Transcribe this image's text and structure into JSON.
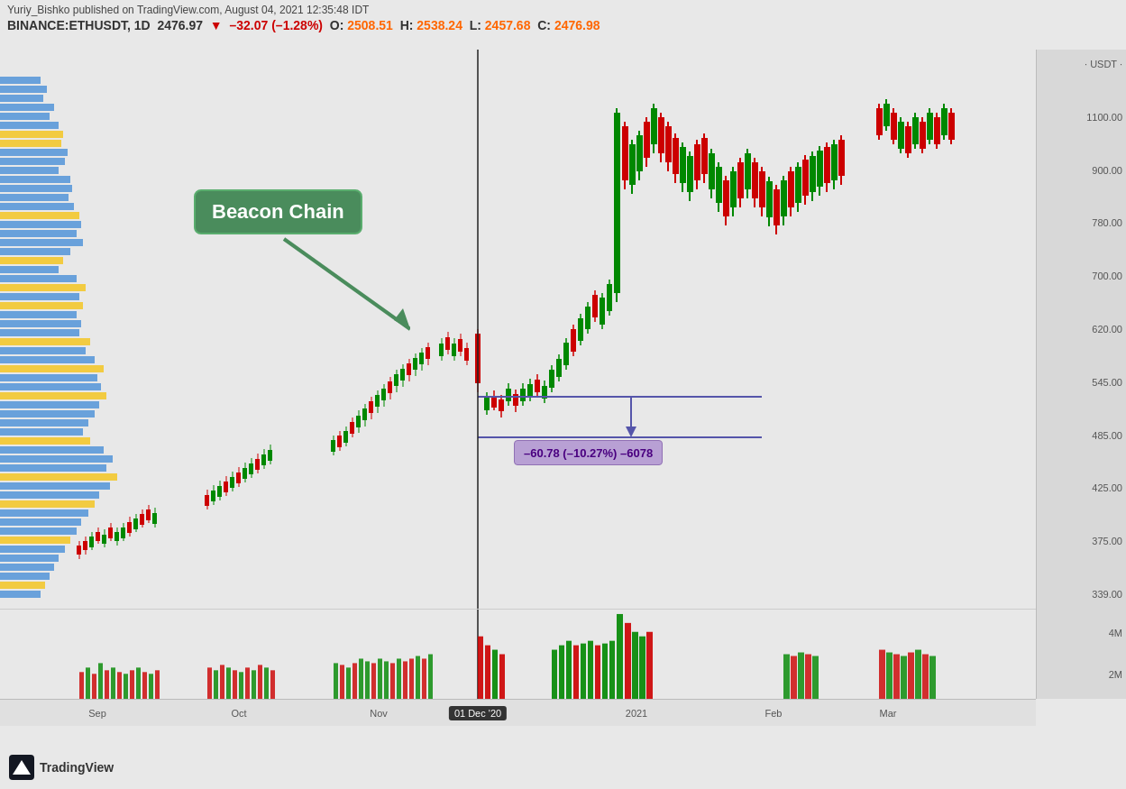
{
  "header": {
    "author": "Yuriy_Bishko published on TradingView.com, August 04, 2021 12:35:48 IDT",
    "symbol": "BINANCE:ETHUSDT, 1D",
    "price": "2476.97",
    "change_icon": "▼",
    "change": "–32.07 (–1.28%)",
    "open_label": "O:",
    "open": "2508.51",
    "high_label": "H:",
    "high": "2538.24",
    "low_label": "L:",
    "low": "2457.68",
    "close_label": "C:",
    "close": "2476.98"
  },
  "annotation": {
    "beacon_chain": "Beacon Chain"
  },
  "measurement": {
    "value": "–60.78 (–10.27%) –6078"
  },
  "price_axis": {
    "labels": [
      "1100.00",
      "900.00",
      "780.00",
      "700.00",
      "620.00",
      "545.00",
      "485.00",
      "425.00",
      "375.00",
      "339.00"
    ]
  },
  "time_axis": {
    "labels": [
      "Sep",
      "Oct",
      "Nov",
      "01 Dec '20",
      "2021",
      "Feb",
      "Mar"
    ],
    "highlighted": "01 Dec '20"
  },
  "volume_axis": {
    "labels": [
      "4M",
      "2M"
    ]
  },
  "tradingview": {
    "name": "TradingView"
  },
  "usdt": "USDT"
}
